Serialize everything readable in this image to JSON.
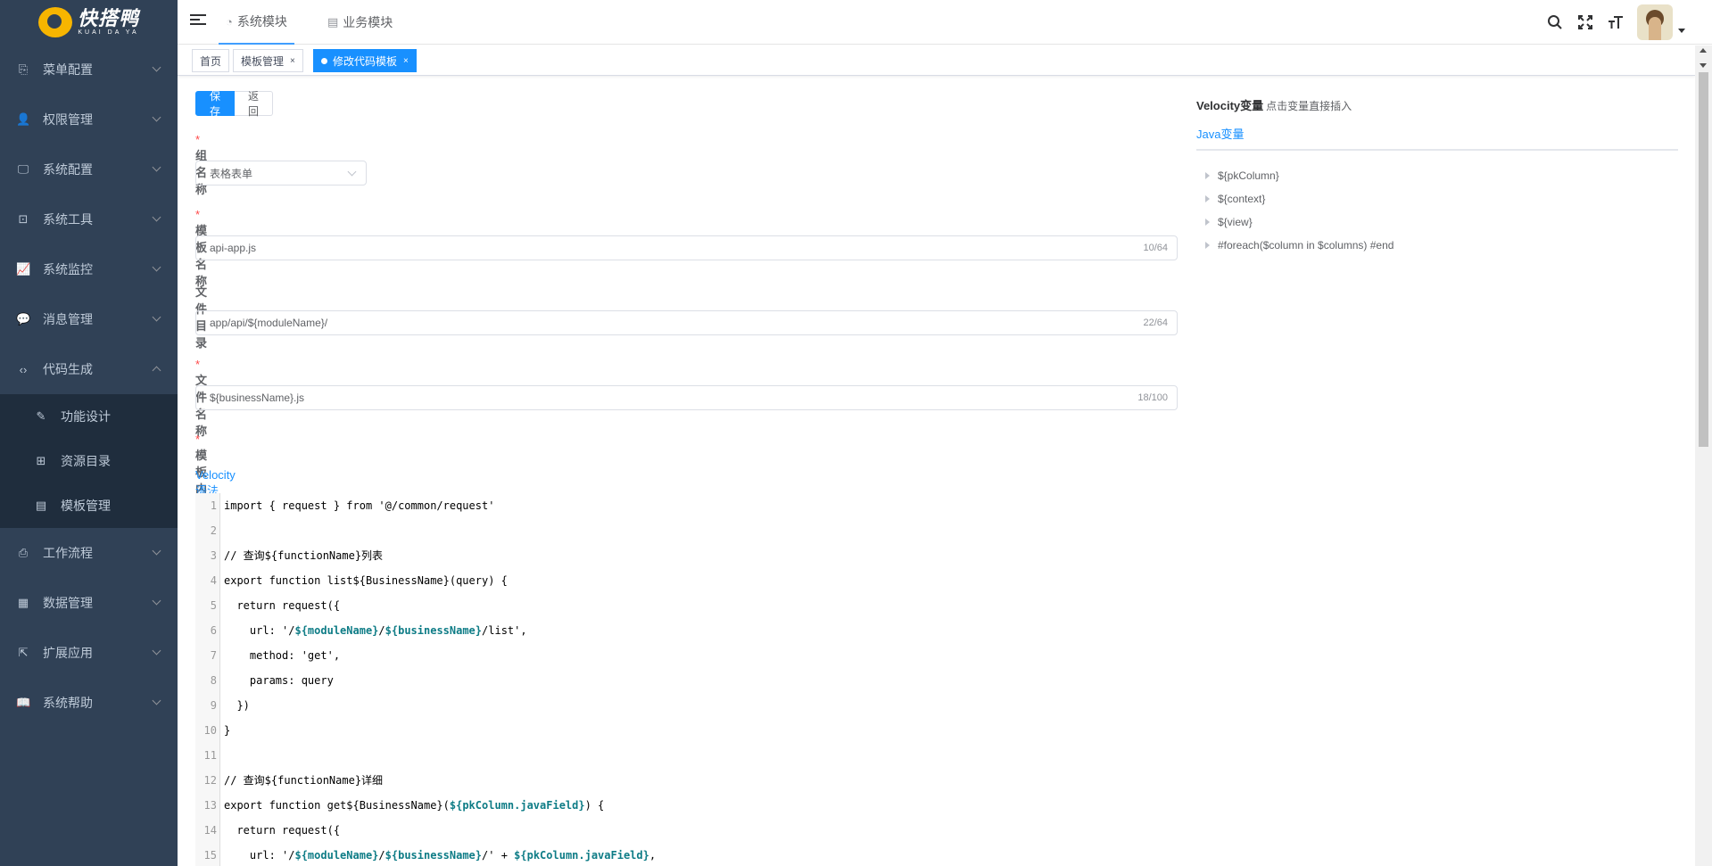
{
  "logo": {
    "title": "快搭鸭",
    "subtitle": "KUAI DA YA"
  },
  "sidebar": {
    "items": [
      {
        "label": "菜单配置",
        "icon": "menu-config-icon"
      },
      {
        "label": "权限管理",
        "icon": "user-permission-icon"
      },
      {
        "label": "系统配置",
        "icon": "monitor-icon"
      },
      {
        "label": "系统工具",
        "icon": "toolbox-icon"
      },
      {
        "label": "系统监控",
        "icon": "chart-monitor-icon"
      },
      {
        "label": "消息管理",
        "icon": "message-icon"
      },
      {
        "label": "代码生成",
        "icon": "code-icon",
        "expanded": true,
        "children": [
          {
            "label": "功能设计",
            "icon": "edit-icon"
          },
          {
            "label": "资源目录",
            "icon": "tree-icon"
          },
          {
            "label": "模板管理",
            "icon": "document-icon"
          }
        ]
      },
      {
        "label": "工作流程",
        "icon": "workflow-icon"
      },
      {
        "label": "数据管理",
        "icon": "grid-icon"
      },
      {
        "label": "扩展应用",
        "icon": "external-link-icon"
      },
      {
        "label": "系统帮助",
        "icon": "book-icon"
      }
    ]
  },
  "navbar": {
    "tabs": [
      {
        "label": "系统模块",
        "icon": "dashboard-icon",
        "active": true
      },
      {
        "label": "业务模块",
        "icon": "book-icon",
        "active": false
      }
    ],
    "icons": [
      "search-icon",
      "fullscreen-icon",
      "font-size-icon"
    ]
  },
  "tags": [
    {
      "label": "首页",
      "active": false
    },
    {
      "label": "模板管理",
      "active": false,
      "closable": true
    },
    {
      "label": "修改代码模板",
      "active": true,
      "closable": true
    }
  ],
  "form": {
    "save_label": "保 存",
    "back_label": "返 回",
    "group_label": "组名称",
    "group_value": "表格表单",
    "template_name_label": "模板名称",
    "template_name_value": "api-app.js",
    "template_name_count": "10/64",
    "file_dir_label": "文件目录",
    "file_dir_value": "app/api/${moduleName}/",
    "file_dir_count": "22/64",
    "file_name_label": "文件名称",
    "file_name_value": "${businessName}.js",
    "file_name_count": "18/100",
    "content_label": "模板内容",
    "syntax_link": "Velocity语法"
  },
  "code": [
    "import { request } from '@/common/request'",
    "",
    "// 查询${functionName}列表",
    "export function list${BusinessName}(query) {",
    "  return request({",
    "    url: '/${moduleName}/${businessName}/list',",
    "    method: 'get',",
    "    params: query",
    "  })",
    "}",
    "",
    "// 查询${functionName}详细",
    "export function get${BusinessName}(${pkColumn.javaField}) {",
    "  return request({",
    "    url: '/${moduleName}/${businessName}/' + ${pkColumn.javaField},"
  ],
  "velocity": {
    "title": "Velocity变量",
    "hint": "点击变量直接插入",
    "tab": "Java变量",
    "items": [
      "${pkColumn}",
      "${context}",
      "${view}",
      "#foreach($column in $columns) #end"
    ]
  }
}
